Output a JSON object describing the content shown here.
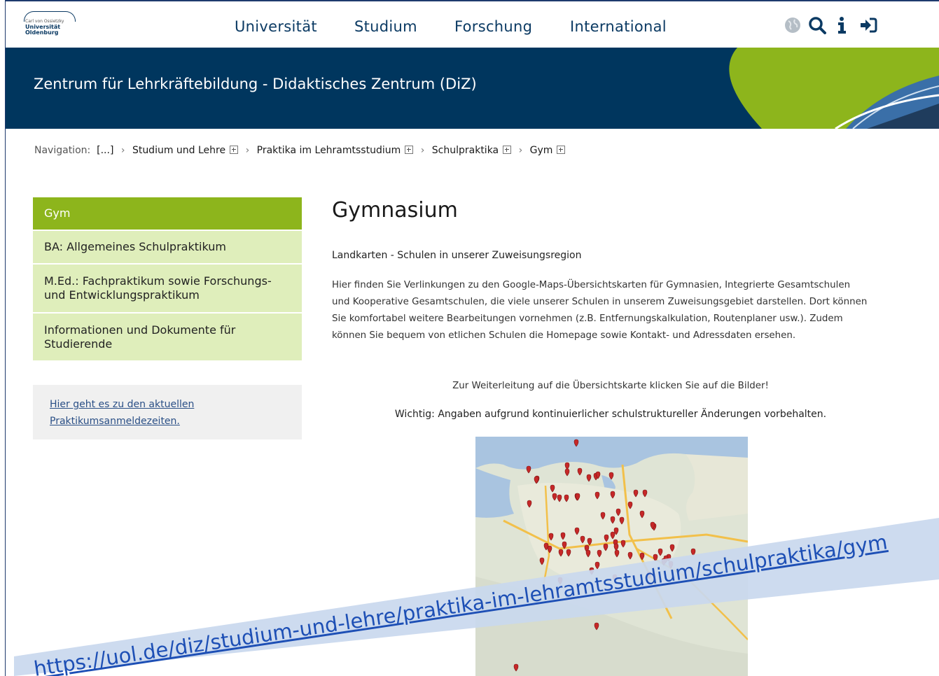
{
  "logo": {
    "line1": "Carl von Ossietzky",
    "line2": "Universität",
    "line3": "Oldenburg"
  },
  "nav": {
    "items": [
      "Universität",
      "Studium",
      "Forschung",
      "International"
    ],
    "icons": [
      "globe-icon",
      "search-icon",
      "info-icon",
      "login-icon"
    ]
  },
  "banner": {
    "title": "Zentrum für Lehrkräftebildung - Didaktisches Zentrum (DiZ)"
  },
  "breadcrumb": {
    "label": "Navigation:",
    "items": [
      "[...]",
      "Studium und Lehre",
      "Praktika im Lehramtsstudium",
      "Schulpraktika",
      "Gym"
    ]
  },
  "sidebar": {
    "items": [
      {
        "label": "Gym",
        "active": true
      },
      {
        "label": "BA: Allgemeines Schulpraktikum",
        "active": false
      },
      {
        "label": "M.Ed.: Fachpraktikum sowie Forschungs- und Entwicklungspraktikum",
        "active": false
      },
      {
        "label": "Informationen und Dokumente für Studierende",
        "active": false
      }
    ],
    "notice_line1": "Hier geht es zu den aktuellen",
    "notice_line2": "Praktikumsanmeldezeiten."
  },
  "main": {
    "heading": "Gymnasium",
    "subheading": "Landkarten - Schulen in unserer Zuweisungsregion",
    "intro_lines": [
      "Hier finden Sie Verlinkungen zu den Google-Maps-Übersichtskarten für Gymnasien, Integrierte Gesamtschulen",
      "und Kooperative Gesamtschulen, die viele unserer Schulen in unserem Zuweisungsgebiet darstellen. Dort können",
      "Sie komfortabel weitere Bearbeitungen vornehmen (z.B. Entfernungskalkulation, Routenplaner usw.). Zudem",
      "können Sie bequem von etlichen Schulen die Homepage sowie Kontakt- und Adressdaten ersehen."
    ],
    "redirect_note": "Zur Weiterleitung auf die Übersichtskarte klicken Sie auf die Bilder!",
    "important_note": "Wichtig: Angaben aufgrund kontinuierlicher schulstruktureller Änderungen vorbehalten."
  },
  "overlay": {
    "url": "https://uol.de/diz/studium-und-lehre/praktika-im-lehramtsstudium/schulpraktika/gym"
  },
  "colors": {
    "brand_blue": "#00365e",
    "brand_green": "#8db51c",
    "sidebar_light": "#dfeebb",
    "marker_red": "#c62828",
    "url_band": "#c9d8ee",
    "url_text": "#1d4fb5"
  }
}
